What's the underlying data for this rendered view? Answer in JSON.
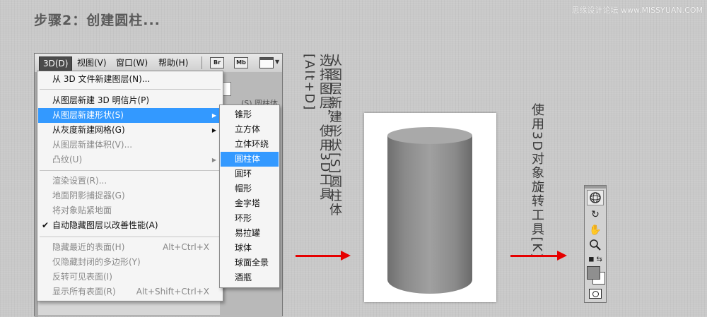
{
  "heading": "步骤2：创建圆柱...",
  "watermark": "思缘设计论坛 www.MISSYUAN.COM",
  "menubar": {
    "items": [
      "3D(D)",
      "视图(V)",
      "窗口(W)",
      "帮助(H)"
    ],
    "buttons": [
      "Br",
      "Mb"
    ]
  },
  "app_tab_text": "(S) 圆柱体",
  "menu": {
    "items": [
      {
        "label": "从 3D 文件新建图层(N)...",
        "shortcut": "",
        "submenu": false,
        "disabled": false,
        "checked": false
      },
      {
        "label": "从图层新建 3D 明信片(P)",
        "shortcut": "",
        "submenu": false,
        "disabled": false,
        "checked": false
      },
      {
        "label": "从图层新建形状(S)",
        "shortcut": "",
        "submenu": true,
        "disabled": false,
        "checked": false,
        "highlighted": true
      },
      {
        "label": "从灰度新建网格(G)",
        "shortcut": "",
        "submenu": true,
        "disabled": false,
        "checked": false
      },
      {
        "label": "从图层新建体积(V)...",
        "shortcut": "",
        "submenu": false,
        "disabled": true,
        "checked": false
      },
      {
        "label": "凸纹(U)",
        "shortcut": "",
        "submenu": true,
        "disabled": true,
        "checked": false
      },
      {
        "label": "渲染设置(R)...",
        "shortcut": "",
        "submenu": false,
        "disabled": true,
        "checked": false
      },
      {
        "label": "地面阴影捕捉器(G)",
        "shortcut": "",
        "submenu": false,
        "disabled": true,
        "checked": false
      },
      {
        "label": "将对象贴紧地面",
        "shortcut": "",
        "submenu": false,
        "disabled": true,
        "checked": false
      },
      {
        "label": "自动隐藏图层以改善性能(A)",
        "shortcut": "",
        "submenu": false,
        "disabled": false,
        "checked": true
      },
      {
        "label": "隐藏最近的表面(H)",
        "shortcut": "Alt+Ctrl+X",
        "submenu": false,
        "disabled": true,
        "checked": false
      },
      {
        "label": "仅隐藏封闭的多边形(Y)",
        "shortcut": "",
        "submenu": false,
        "disabled": true,
        "checked": false
      },
      {
        "label": "反转可见表面(I)",
        "shortcut": "",
        "submenu": false,
        "disabled": true,
        "checked": false
      },
      {
        "label": "显示所有表面(R)",
        "shortcut": "Alt+Shift+Ctrl+X",
        "submenu": false,
        "disabled": true,
        "checked": false
      }
    ]
  },
  "submenu": {
    "items": [
      "锥形",
      "立方体",
      "立体环绕",
      "圆柱体",
      "圆环",
      "帽形",
      "金字塔",
      "环形",
      "易拉罐",
      "球体",
      "球面全景",
      "酒瓶"
    ],
    "highlighted": "圆柱体"
  },
  "captions": {
    "choose_layer": "选择图层，使用3D工具[Alt+D]",
    "from_layer": "从图层新建形状[S]圆柱体",
    "rotate_tool": "使用3D对象旋转工具[K]"
  },
  "tools": {
    "icons": [
      "3d-rotate-icon",
      "3d-roll-icon",
      "hand-pan-icon",
      "zoom-icon",
      "swap-colors-icon",
      "color-swatch-icon",
      "quick-mask-icon"
    ]
  },
  "colors": {
    "accent_arrow": "#e60000",
    "menu_highlight": "#3399ff"
  }
}
